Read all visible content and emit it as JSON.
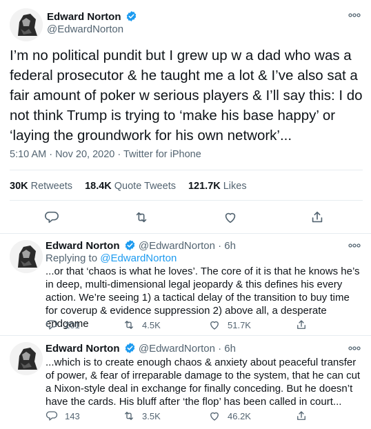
{
  "main_tweet": {
    "author_name": "Edward Norton",
    "author_handle": "@EdwardNorton",
    "text": "I’m no political pundit but I grew up w a dad who was a federal prosecutor & he taught me a lot & I’ve also sat a fair amount of poker w serious players & I’ll say this: I do not think Trump is trying to ‘make his base happy’ or ‘laying the groundwork for his own network’...",
    "meta": "5:10 AM · Nov 20, 2020 · Twitter for iPhone",
    "stats": {
      "retweets_count": "30K",
      "retweets_label": "Retweets",
      "quotes_count": "18.4K",
      "quotes_label": "Quote Tweets",
      "likes_count": "121.7K",
      "likes_label": "Likes"
    }
  },
  "replies": [
    {
      "author_name": "Edward Norton",
      "author_handle": "@EdwardNorton",
      "time": "6h",
      "replying_prefix": "Replying to",
      "replying_to": "@EdwardNorton",
      "text": "...or that ‘chaos is what he loves’. The core of it is that he knows he’s in deep, multi-dimensional legal jeopardy & this defines his every action. We’re seeing 1) a tactical delay of the transition to buy time for coverup & evidence suppression 2) above all, a desperate endgame",
      "replies": "201",
      "retweets": "4.5K",
      "likes": "51.7K"
    },
    {
      "author_name": "Edward Norton",
      "author_handle": "@EdwardNorton",
      "time": "6h",
      "text": "...which is to create enough chaos & anxiety about peaceful transfer of power, & fear of irreparable damage to the system, that he can cut a Nixon-style deal in exchange for finally conceding. But he doesn’t have the cards. His bluff after ‘the flop’ has been called in court...",
      "replies": "143",
      "retweets": "3.5K",
      "likes": "46.2K"
    }
  ],
  "colors": {
    "accent": "#1d9bf0",
    "muted": "#536471",
    "text": "#0f1419",
    "divider": "#e6ecf0"
  }
}
